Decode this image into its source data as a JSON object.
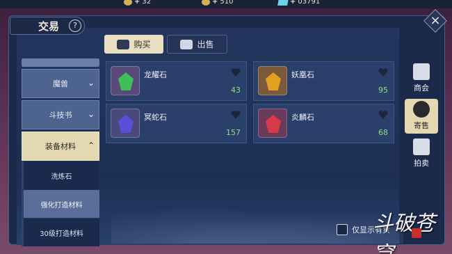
{
  "resources": [
    {
      "value": "32",
      "kind": "coin-icon"
    },
    {
      "value": "510",
      "kind": "coin-icon"
    },
    {
      "value": "03791",
      "kind": "gem-icon"
    }
  ],
  "header": {
    "title": "交易",
    "help": "?",
    "close": "×"
  },
  "tabs": {
    "buy": "购买",
    "sell": "出售"
  },
  "sidebar": {
    "categories": [
      {
        "label": "魔兽"
      },
      {
        "label": "斗技书"
      },
      {
        "label": "装备材料"
      }
    ],
    "subitems": [
      {
        "label": "洗炼石"
      },
      {
        "label": "强化打造材料"
      },
      {
        "label": "30级打造材料"
      }
    ]
  },
  "items": [
    {
      "name": "龙耀石",
      "count": "43",
      "color": "#3fbf5a"
    },
    {
      "name": "妖凰石",
      "count": "95",
      "color": "#e0a020"
    },
    {
      "name": "冥蛇石",
      "count": "157",
      "color": "#5a4fd8"
    },
    {
      "name": "炎麟石",
      "count": "68",
      "color": "#d83a4a"
    }
  ],
  "toggle_label": "仅显示有货",
  "rightnav": [
    {
      "label": "商会",
      "icon": "abacus-icon"
    },
    {
      "label": "寄售",
      "icon": "coin-pouch-icon"
    },
    {
      "label": "拍卖",
      "icon": "gavel-icon"
    }
  ],
  "watermark": "斗破苍穹"
}
